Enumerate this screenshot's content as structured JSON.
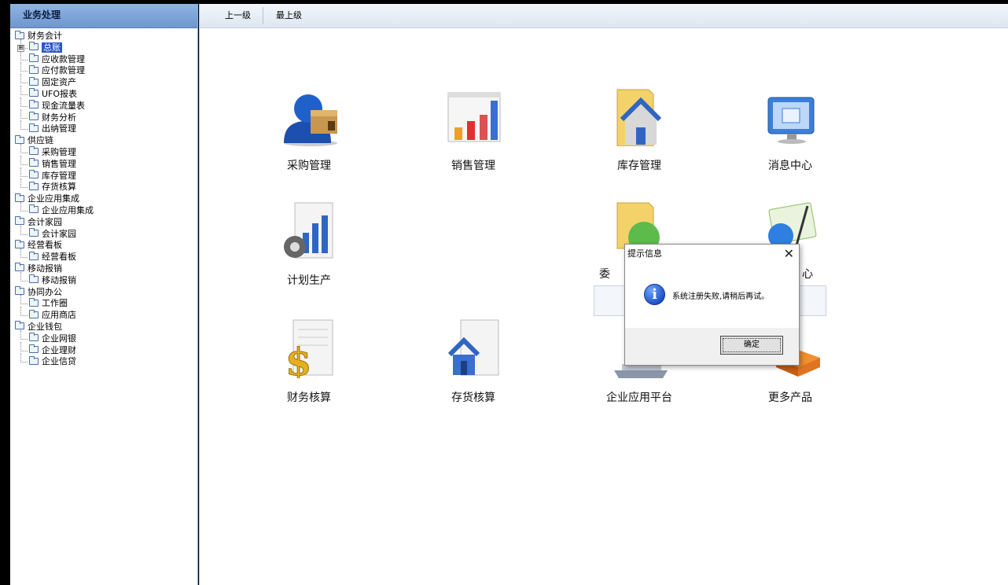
{
  "left": {
    "header": "业务处理",
    "tree": [
      {
        "label": "财务会计",
        "level": 0
      },
      {
        "label": "总账",
        "level": 1,
        "selected": true,
        "expander": "⊞"
      },
      {
        "label": "应收款管理",
        "level": 1
      },
      {
        "label": "应付款管理",
        "level": 1
      },
      {
        "label": "固定资产",
        "level": 1
      },
      {
        "label": "UFO报表",
        "level": 1
      },
      {
        "label": "现金流量表",
        "level": 1
      },
      {
        "label": "财务分析",
        "level": 1
      },
      {
        "label": "出纳管理",
        "level": 1
      },
      {
        "label": "供应链",
        "level": 0
      },
      {
        "label": "采购管理",
        "level": 1
      },
      {
        "label": "销售管理",
        "level": 1
      },
      {
        "label": "库存管理",
        "level": 1
      },
      {
        "label": "存货核算",
        "level": 1
      },
      {
        "label": "企业应用集成",
        "level": 0
      },
      {
        "label": "企业应用集成",
        "level": 1
      },
      {
        "label": "会计家园",
        "level": 0
      },
      {
        "label": "会计家园",
        "level": 1
      },
      {
        "label": "经营看板",
        "level": 0
      },
      {
        "label": "经营看板",
        "level": 1
      },
      {
        "label": "移动报销",
        "level": 0
      },
      {
        "label": "移动报销",
        "level": 1
      },
      {
        "label": "协同办公",
        "level": 0
      },
      {
        "label": "工作圈",
        "level": 1
      },
      {
        "label": "应用商店",
        "level": 1
      },
      {
        "label": "企业钱包",
        "level": 0
      },
      {
        "label": "企业网银",
        "level": 1
      },
      {
        "label": "企业理财",
        "level": 1
      },
      {
        "label": "企业信贷",
        "level": 1
      }
    ]
  },
  "toolbar": {
    "up_label": "上一级",
    "top_label": "最上级"
  },
  "apps": {
    "purchase": "采购管理",
    "sales": "销售管理",
    "inventory": "库存管理",
    "message": "消息中心",
    "planning": "计划生产",
    "hidden1_partial": "委",
    "hidden2_partial": "心",
    "finance": "财务核算",
    "stock": "存货核算",
    "platform": "企业应用平台",
    "more": "更多产品"
  },
  "dialog": {
    "title": "提示信息",
    "close": "✕",
    "message": "系统注册失败,请稍后再试。",
    "ok": "确定",
    "info_glyph": "i"
  },
  "colors": {
    "header_blue": "#7ba2d8",
    "selected": "#2a55c8"
  }
}
